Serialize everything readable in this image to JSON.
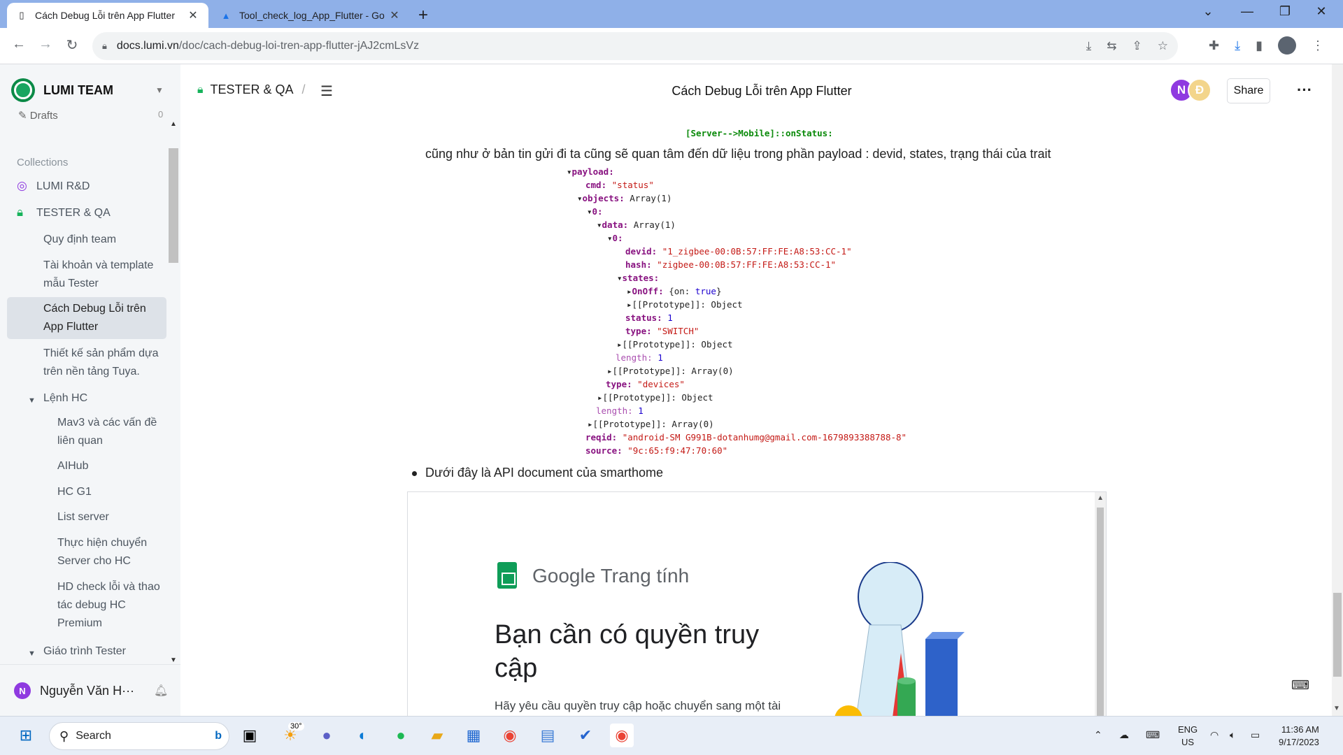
{
  "browser": {
    "tabs": [
      {
        "title": "Cách Debug Lỗi trên App Flutter",
        "active": true
      },
      {
        "title": "Tool_check_log_App_Flutter - Go",
        "active": false
      }
    ],
    "url_host": "docs.lumi.vn",
    "url_path": "/doc/cach-debug-loi-tren-app-flutter-jAJ2cmLsVz"
  },
  "sidebar": {
    "team_name": "LUMI TEAM",
    "drafts_label": "Drafts",
    "drafts_count": "0",
    "collections_label": "Collections",
    "collections": [
      {
        "label": "LUMI R&D",
        "color": "#8f3ae0"
      },
      {
        "label": "TESTER & QA",
        "color": "#16b35b"
      }
    ],
    "docs": [
      {
        "label": "Quy định team"
      },
      {
        "label": "Tài khoản và template mẫu Tester"
      },
      {
        "label": "Cách Debug Lỗi trên App Flutter",
        "active": true
      },
      {
        "label": "Thiết kế sản phẩm dựa trên nền tảng Tuya."
      },
      {
        "label": "Lệnh HC",
        "expanded": true
      },
      {
        "label": "Mav3 và các vấn đề liên quan"
      },
      {
        "label": "AIHub"
      },
      {
        "label": "HC G1"
      },
      {
        "label": "List server"
      },
      {
        "label": "Thực hiện chuyển Server cho HC"
      },
      {
        "label": "HD check lỗi và thao tác debug HC Premium"
      },
      {
        "label": "Giáo trình Tester",
        "expanded": true
      }
    ],
    "user_initial": "N",
    "user_name": "Nguyễn Văn H···"
  },
  "header": {
    "breadcrumb": "TESTER & QA",
    "doc_title": "Cách Debug Lỗi trên App Flutter",
    "avatars": [
      {
        "initial": "N",
        "color": "#8f3ae0"
      },
      {
        "initial": "Đ",
        "color": "#f3d58b"
      }
    ],
    "share_label": "Share"
  },
  "content": {
    "server_label": "[Server-->Mobile]::onStatus:",
    "para1": "cũng như ở bản tin gửi đi ta cũng sẽ quan tâm đến dữ liệu trong phần payload : devid, states, trạng thái của trait",
    "bullet1": "Dưới đây là API document của smarthome",
    "code": {
      "payload": "payload:",
      "cmd_key": "cmd:",
      "cmd_val": "\"status\"",
      "objects_key": "objects:",
      "objects_val": "Array(1)",
      "idx0": "0:",
      "data_key": "data:",
      "data_val": "Array(1)",
      "idx0b": "0:",
      "devid_key": "devid:",
      "devid_val": "\"1_zigbee-00:0B:57:FF:FE:A8:53:CC-1\"",
      "hash_key": "hash:",
      "hash_val": "\"zigbee-00:0B:57:FF:FE:A8:53:CC-1\"",
      "states_key": "states:",
      "onoff_key": "OnOff:",
      "onoff_val1": "{on: ",
      "onoff_val2": "true",
      "onoff_val3": "}",
      "proto_obj": "[[Prototype]]: Object",
      "status_key": "status:",
      "status_val": "1",
      "type_key": "type:",
      "type_val": "\"SWITCH\"",
      "proto_obj2": "[[Prototype]]: Object",
      "length_key": "length:",
      "length_val": "1",
      "proto_arr": "[[Prototype]]: Array(0)",
      "type2_key": "type:",
      "type2_val": "\"devices\"",
      "proto_obj3": "[[Prototype]]: Object",
      "length2_key": "length:",
      "length2_val": "1",
      "proto_arr2": "[[Prototype]]: Array(0)",
      "reqid_key": "reqid:",
      "reqid_val": "\"android-SM G991B-dotanhumg@gmail.com-1679893388788-8\"",
      "source_key": "source:",
      "source_val": "\"9c:65:f9:47:70:60\""
    },
    "embed": {
      "brand_google": "Google",
      "brand_product": "Trang tính",
      "heading": "Bạn cần có quyền truy cập",
      "sub": "Hãy yêu cầu quyền truy cập hoặc chuyển sang một tài"
    }
  },
  "taskbar": {
    "search_placeholder": "Search",
    "weather": "30°",
    "lang1": "ENG",
    "lang2": "US",
    "time": "11:36 AM",
    "date": "9/17/2023"
  }
}
